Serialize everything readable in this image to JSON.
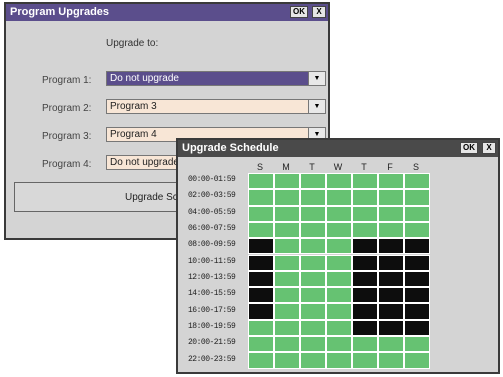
{
  "win1": {
    "title": "Program Upgrades",
    "ok_label": "OK",
    "close_label": "X",
    "upgrade_caption": "Upgrade to:",
    "programs": [
      {
        "label": "Program 1:",
        "value": "Do not upgrade",
        "selected": true
      },
      {
        "label": "Program 2:",
        "value": "Program 3",
        "selected": false
      },
      {
        "label": "Program 3:",
        "value": "Program 4",
        "selected": false
      },
      {
        "label": "Program 4:",
        "value": "Do not upgrade",
        "selected": false
      }
    ],
    "button_label": "Upgrade Schedule"
  },
  "win2": {
    "title": "Upgrade Schedule",
    "ok_label": "OK",
    "close_label": "X",
    "days": [
      "S",
      "M",
      "T",
      "W",
      "T",
      "F",
      "S"
    ],
    "times": [
      "00:00-01:59",
      "02:00-03:59",
      "04:00-05:59",
      "06:00-07:59",
      "08:00-09:59",
      "10:00-11:59",
      "12:00-13:59",
      "14:00-15:59",
      "16:00-17:59",
      "18:00-19:59",
      "20:00-21:59",
      "22:00-23:59"
    ],
    "rows": [
      [
        0,
        0,
        0,
        0,
        0,
        0,
        0
      ],
      [
        0,
        0,
        0,
        0,
        0,
        0,
        0
      ],
      [
        0,
        0,
        0,
        0,
        0,
        0,
        0
      ],
      [
        0,
        0,
        0,
        0,
        0,
        0,
        0
      ],
      [
        1,
        0,
        0,
        0,
        1,
        1,
        1
      ],
      [
        1,
        0,
        0,
        0,
        1,
        1,
        1
      ],
      [
        1,
        0,
        0,
        0,
        1,
        1,
        1
      ],
      [
        1,
        0,
        0,
        0,
        1,
        1,
        1
      ],
      [
        1,
        0,
        0,
        0,
        1,
        1,
        1
      ],
      [
        0,
        0,
        0,
        0,
        1,
        1,
        1
      ],
      [
        0,
        0,
        0,
        0,
        0,
        0,
        0
      ],
      [
        0,
        0,
        0,
        0,
        0,
        0,
        0
      ]
    ]
  },
  "colors": {
    "allowed": "#66c272",
    "blocked": "#0d0d0d",
    "selection": "#5b4e8c",
    "field": "#f8e6d6"
  }
}
